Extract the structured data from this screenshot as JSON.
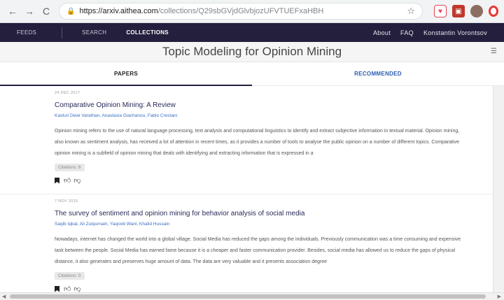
{
  "browser": {
    "url_host": "https://arxiv.aithea.com",
    "url_path": "/collections/Q29sbGVjdGlvbjozUFVTUEFxaHBH"
  },
  "nav": {
    "feeds": "FEEDS",
    "search": "SEARCH",
    "collections": "COLLECTIONS",
    "about": "About",
    "faq": "FAQ",
    "user": "Konstantin Vorontsov"
  },
  "page": {
    "title": "Topic Modeling for Opinion Mining"
  },
  "tabs": {
    "papers": "PAPERS",
    "recommended": "RECOMMENDED"
  },
  "papers": [
    {
      "date": "24 DEC 2017",
      "title": "Comparative Opinion Mining: A Review",
      "authors": "Kasturi Dewi Varathan, Anastasia Giachanou, Fabio Crestani",
      "abstract": "Opinion mining refers to the use of natural language processing, text analysis and computational linguistics to identify and extract subjective information in textual material. Opinion mining, also known as sentiment analysis, has received a lot of attention in recent times, as it provides a number of tools to analyse the public opinion on a number of different topics. Comparative opinion mining is a subfield of opinion mining that deals with identifying and extracting information that is expressed in a",
      "citations": "Citations: 6"
    },
    {
      "date": "7 NOV 2015",
      "title": "The survey of sentiment and opinion mining for behavior analysis of social media",
      "authors": "Saqib Iqbal, Ali Zulqurnain, Yaqoob Wani, Khalid Hussain",
      "abstract": "Nowadays, internet has changed the world into a global village. Social Media has reduced the gaps among the individuals. Previously communication was a time consuming and expensive task between the people. Social Media has earned fame because it is a cheaper and faster communication provider. Besides, social media has allowed us to reduce the gaps of physical distance, it also generates and preserves huge amount of data. The data are very valuable and it presents association degree",
      "citations": "Citations: 0"
    }
  ]
}
